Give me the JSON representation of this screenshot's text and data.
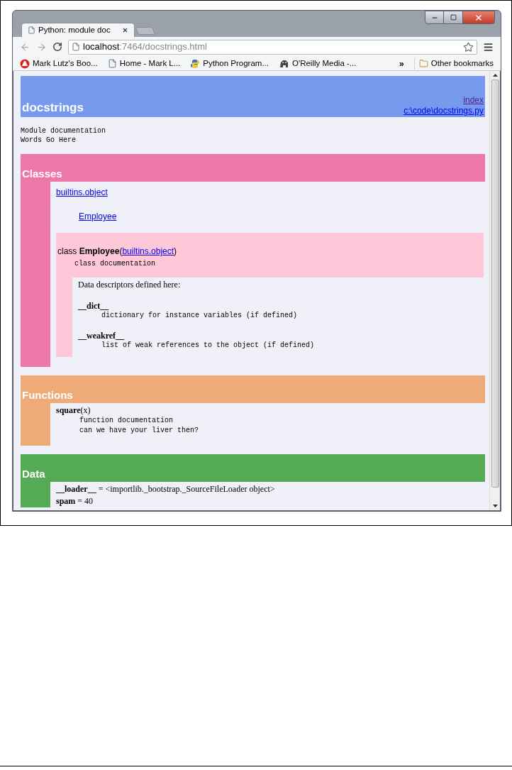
{
  "browser": {
    "tab": {
      "title": "Python: module doc",
      "selected": true
    },
    "address": {
      "host": "localhost",
      "path": ":7464/docstrings.html"
    },
    "bookmarks": [
      {
        "label": "Mark Lutz's Boo..."
      },
      {
        "label": "Home - Mark L..."
      },
      {
        "label": "Python Program..."
      },
      {
        "label": "O'Reilly Media -..."
      }
    ],
    "more_bookmarks": "»",
    "other_bookmarks": "Other bookmarks"
  },
  "page": {
    "module": {
      "title": "docstrings",
      "links": [
        {
          "text": "index",
          "visited": true
        },
        {
          "text": "c:\\code\\docstrings.py",
          "visited": false
        }
      ]
    },
    "doc": [
      "Module documentation",
      "Words Go Here"
    ],
    "sections": [
      {
        "kind": "classes",
        "title": "Classes",
        "color": "#ee77aa",
        "tree": [
          {
            "text": "builtins.object",
            "children": [
              {
                "text": "Employee"
              }
            ]
          }
        ],
        "classes": [
          {
            "signature": [
              {
                "text": "class ",
                "kind": "plain"
              },
              {
                "text": "Employee",
                "kind": "bold"
              },
              {
                "text": "(",
                "kind": "plain"
              },
              {
                "text": "builtins.object",
                "kind": "link"
              },
              {
                "text": ")",
                "kind": "plain"
              }
            ],
            "doc": "class documentation",
            "descriptors_title": "Data descriptors defined here:",
            "descriptors": [
              {
                "name": "__dict__",
                "doc": "dictionary for instance variables (if defined)"
              },
              {
                "name": "__weakref__",
                "doc": "list of weak references to the object (if defined)"
              }
            ]
          }
        ]
      },
      {
        "kind": "functions",
        "title": "Functions",
        "color": "#eeaa77",
        "functions": [
          {
            "name": "square",
            "args": "(x)",
            "doc": [
              "function documentation",
              "can we have your liver then?"
            ]
          }
        ]
      },
      {
        "kind": "data",
        "title": "Data",
        "color": "#55aa55",
        "items": [
          {
            "name": "__loader__",
            "value": " = <importlib._bootstrap._SourceFileLoader object>"
          },
          {
            "name": "spam",
            "value": " = 40"
          }
        ]
      }
    ]
  }
}
